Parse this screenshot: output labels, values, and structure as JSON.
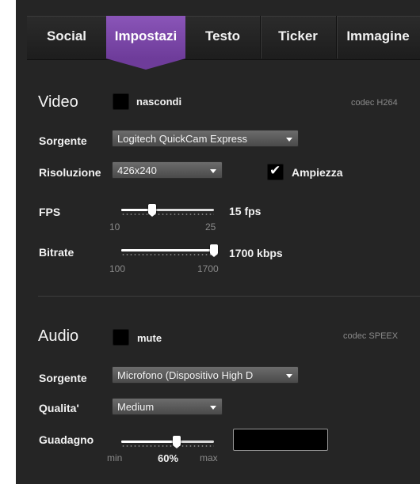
{
  "tabs": [
    {
      "label": "Social",
      "active": false
    },
    {
      "label": "Impostazi",
      "active": true
    },
    {
      "label": "Testo",
      "active": false
    },
    {
      "label": "Ticker",
      "active": false
    },
    {
      "label": "Immagine",
      "active": false
    }
  ],
  "colors": {
    "panel_bg": "#252525",
    "active_tab": "#7a47a8"
  },
  "video": {
    "title": "Video",
    "hide_label": "nascondi",
    "hide_checked": false,
    "codec": "codec H264",
    "source_label": "Sorgente",
    "source_value": "Logitech QuickCam Express",
    "resolution_label": "Risoluzione",
    "resolution_value": "426x240",
    "width_label": "Ampiezza",
    "width_checked": true,
    "fps": {
      "label": "FPS",
      "min_label": "10",
      "max_label": "25",
      "value_label": "15 fps",
      "fraction": 0.33
    },
    "bitrate": {
      "label": "Bitrate",
      "min_label": "100",
      "max_label": "1700",
      "value_label": "1700 kbps",
      "fraction": 1.0
    }
  },
  "audio": {
    "title": "Audio",
    "mute_label": "mute",
    "mute_checked": false,
    "codec": "codec SPEEX",
    "source_label": "Sorgente",
    "source_value": "Microfono (Dispositivo High D",
    "quality_label": "Qualita'",
    "quality_value": "Medium",
    "gain": {
      "label": "Guadagno",
      "min_label": "min",
      "max_label": "max",
      "value_label": "60%",
      "fraction": 0.6
    },
    "gain_input_value": ""
  },
  "icons": {
    "dropdown": "chevron-down-icon",
    "check": "checkmark-icon"
  }
}
